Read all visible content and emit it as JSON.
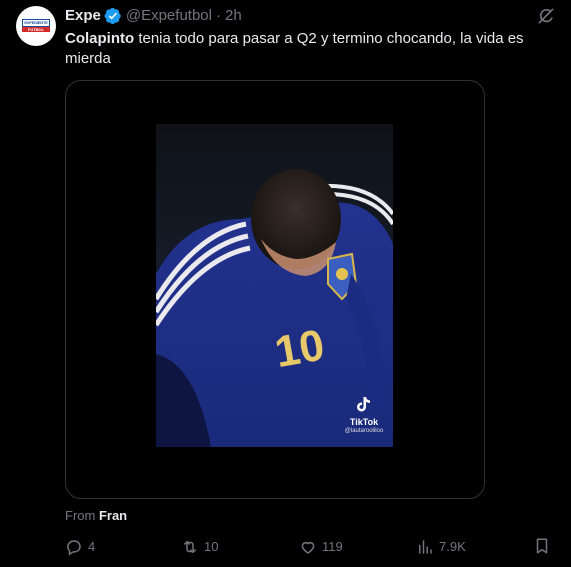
{
  "author": {
    "display_name": "Expe",
    "handle": "@Expefutbol",
    "separator": "·",
    "time": "2h",
    "avatar_logo_top": "EXPEDIENTE",
    "avatar_logo_bottom": "FUTBOL"
  },
  "tweet": {
    "bold_word": "Colapinto",
    "text_rest": " tenia todo para pasar a Q2 y termino chocando, la vida es mierda"
  },
  "media": {
    "jersey_number": "10",
    "watermark_label": "TikTok",
    "watermark_user": "@lautarooliloo"
  },
  "source": {
    "prefix": "From ",
    "name": "Fran"
  },
  "actions": {
    "replies": "4",
    "retweets": "10",
    "likes": "119",
    "views": "7.9K"
  },
  "colors": {
    "background": "#000000",
    "text_primary": "#e7e9ea",
    "text_secondary": "#71767b",
    "verified": "#1d9bf0",
    "border": "#2f3336"
  },
  "icons": {
    "verified": "verified-badge-icon",
    "grok": "grok-icon",
    "reply": "reply-icon",
    "retweet": "retweet-icon",
    "like": "heart-icon",
    "views": "views-icon",
    "bookmark": "bookmark-icon"
  }
}
